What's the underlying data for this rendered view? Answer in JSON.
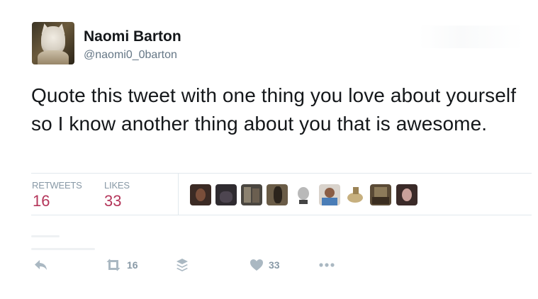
{
  "user": {
    "name": "Naomi Barton",
    "handle": "@naomi0_0barton"
  },
  "tweet": {
    "text": "Quote this tweet with one thing you love about yourself so I know another thing about you that is awesome."
  },
  "stats": {
    "retweets_label": "RETWEETS",
    "retweets_value": "16",
    "likes_label": "LIKES",
    "likes_value": "33"
  },
  "actions": {
    "reply_icon": "reply-icon",
    "retweet_icon": "retweet-icon",
    "retweet_count": "16",
    "buffer_icon": "layers-icon",
    "like_icon": "heart-icon",
    "like_count": "33",
    "more_icon": "more-dots-icon"
  },
  "colors": {
    "stat_value": "#b4355a",
    "muted": "#8899a6",
    "icon": "#aab8c2"
  }
}
